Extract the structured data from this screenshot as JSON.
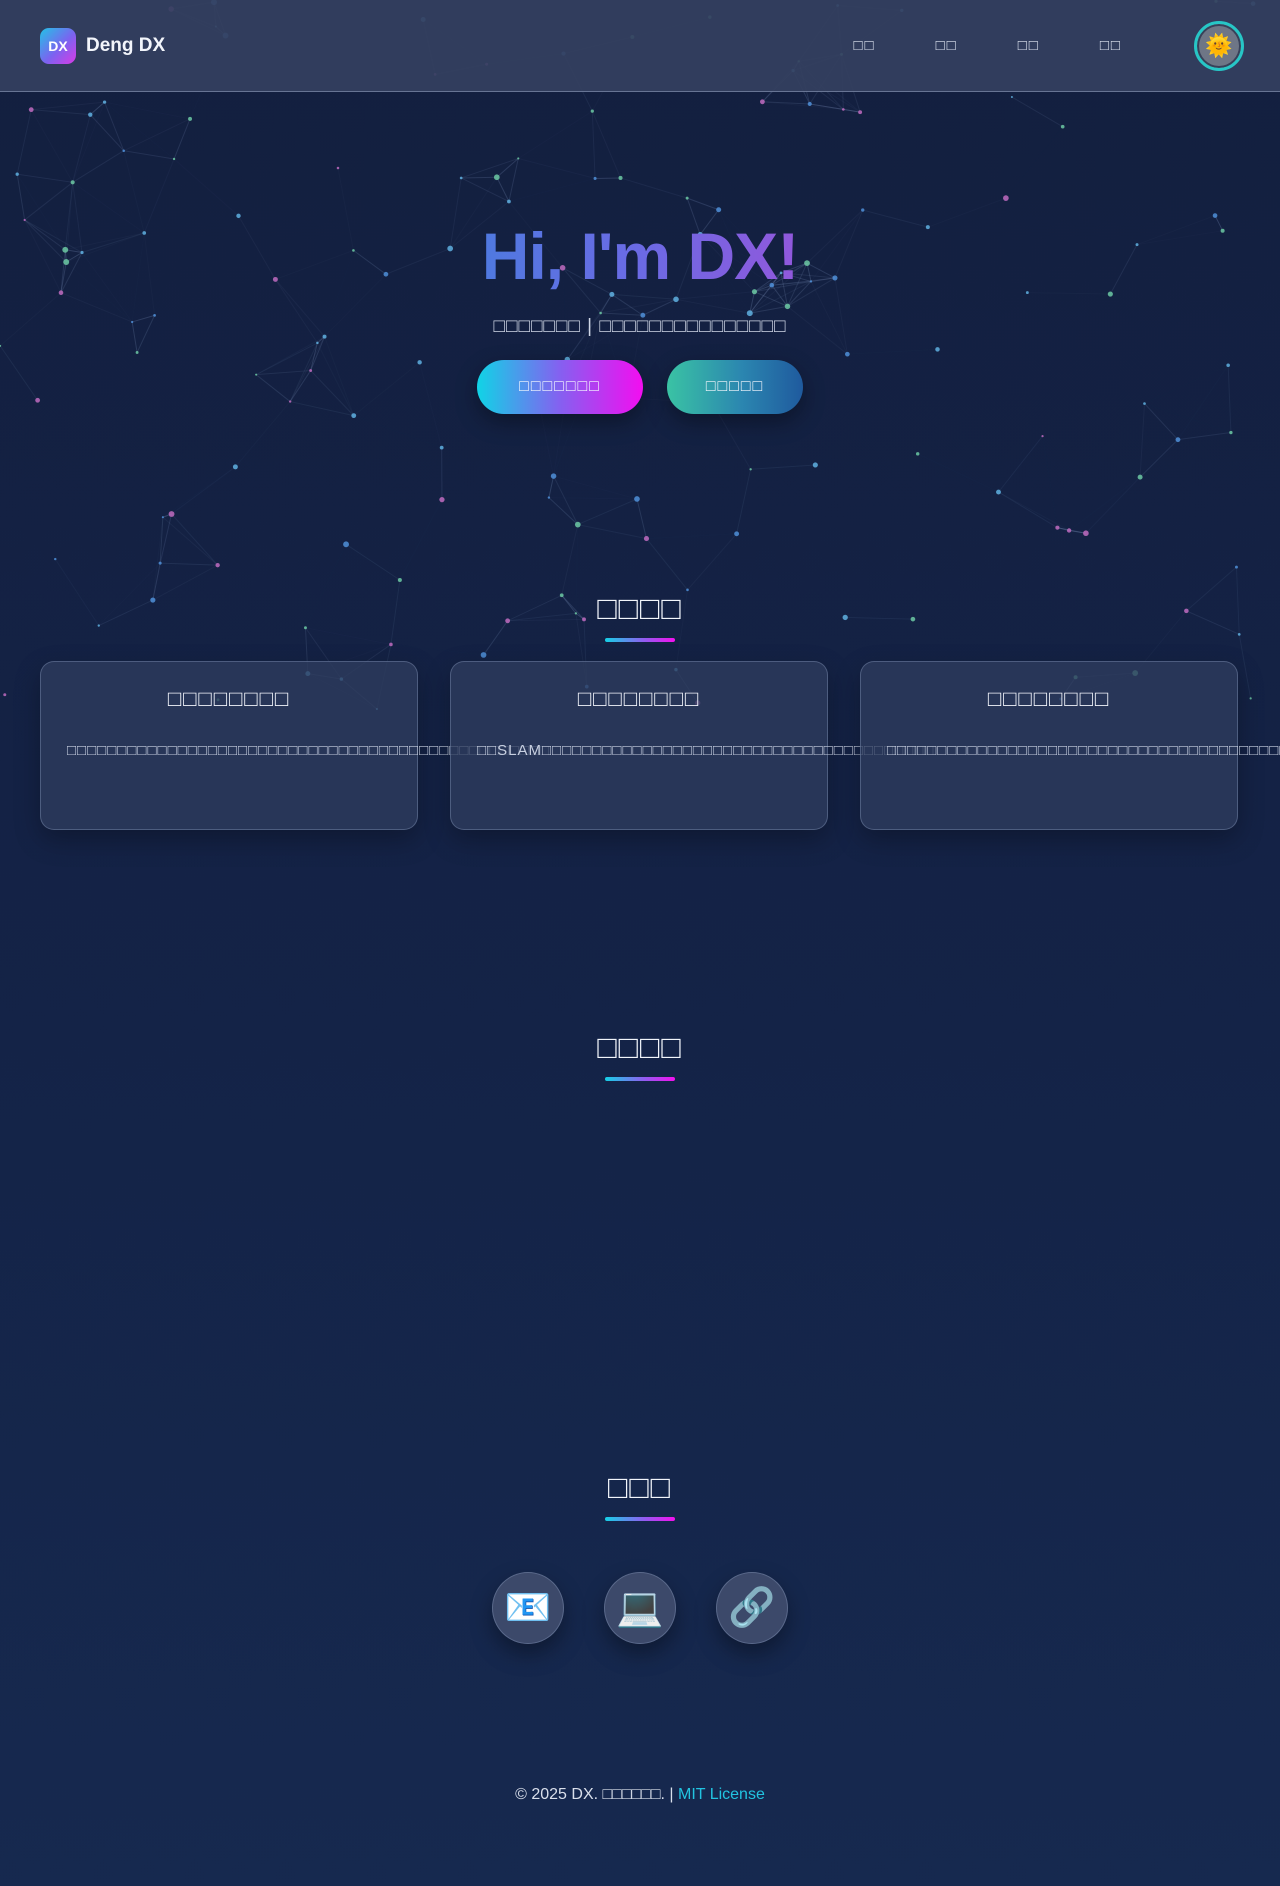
{
  "header": {
    "logo_badge": "DX",
    "logo_text": "Deng DX",
    "nav": [
      "□□",
      "□□",
      "□□",
      "□□"
    ],
    "theme_toggle_icon": "🌞"
  },
  "hero": {
    "title": "Hi, I'm DX!",
    "subtitle": "□□□□□□□ | □□□□□□□□□□□□□□□",
    "buttons": {
      "primary": "□□□□□□□",
      "secondary": "□□□□□"
    }
  },
  "sections": {
    "research": {
      "title": "□□□□",
      "cards": [
        {
          "title": "□□□□□□□□",
          "desc": "□□□□□□□□□□□□□□□□□□□□□□□□□□□□□□□□□□□□□□□□□□□□□□□□"
        },
        {
          "title": "□□□□□□□□",
          "desc": "□□SLAM□□□□□□□□□□□□□□□□□□□□□□□□□□□□□□□□□□□□□□□"
        },
        {
          "title": "□□□□□□□□",
          "desc": "□□□□□□□□□□□□□□□□□□□□□□□□□□□□□□□□□□□□□□□□□"
        }
      ]
    },
    "projects": {
      "title": "□□□□"
    },
    "contact": {
      "title": "□□□",
      "icons": [
        {
          "name": "email-icon",
          "glyph": "📧"
        },
        {
          "name": "laptop-icon",
          "glyph": "💻"
        },
        {
          "name": "link-icon",
          "glyph": "🔗"
        }
      ]
    }
  },
  "footer": {
    "text": "© 2025 DX. □□□□□□. | ",
    "license": "MIT License"
  },
  "colors": {
    "background": "#142347",
    "accent_cyan": "#22c3e0",
    "accent_magenta": "#f30ef0",
    "accent_purple": "#8560f0"
  }
}
